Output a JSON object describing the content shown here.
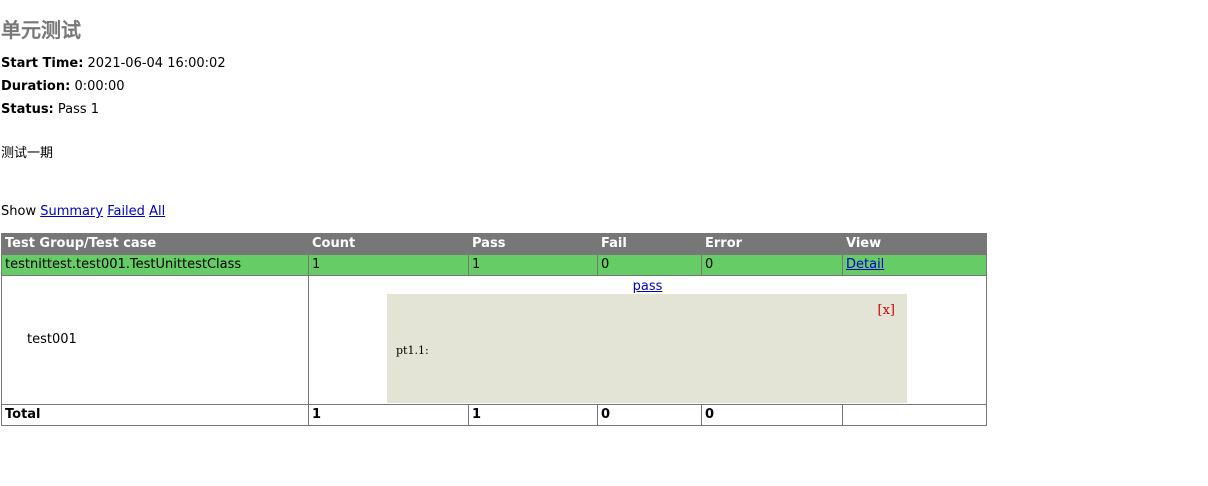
{
  "report": {
    "title": "单元测试",
    "start_time_label": "Start Time:",
    "start_time": "2021-06-04 16:00:02",
    "duration_label": "Duration:",
    "duration": "0:00:00",
    "status_label": "Status:",
    "status": "Pass 1",
    "description": "测试一期"
  },
  "filter": {
    "show_label": "Show",
    "summary": "Summary",
    "failed": "Failed",
    "all": "All"
  },
  "table": {
    "headers": [
      "Test Group/Test case",
      "Count",
      "Pass",
      "Fail",
      "Error",
      "View"
    ],
    "class_row": {
      "name": "testnittest.test001.TestUnittestClass",
      "count": "1",
      "pass": "1",
      "fail": "0",
      "error": "0",
      "view": "Detail"
    },
    "case_row": {
      "name": "test001",
      "status_link": "pass",
      "popup_close": "[x]",
      "popup_output": "pt1.1:"
    },
    "total_row": {
      "label": "Total",
      "count": "1",
      "pass": "1",
      "fail": "0",
      "error": "0"
    }
  },
  "colors": {
    "header_bg": "#777777",
    "pass_class_bg": "#66cc66",
    "popup_bg": "#e4e4d6",
    "close_color": "#cc0000",
    "link_color": "#0000cc"
  }
}
